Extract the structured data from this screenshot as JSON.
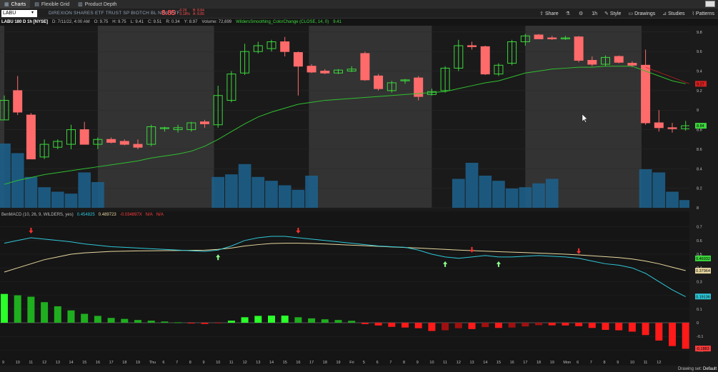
{
  "tabs": [
    {
      "label": "Charts",
      "icon": "chart-icon",
      "active": true
    },
    {
      "label": "Flexible Grid",
      "icon": "grid-icon",
      "active": false
    },
    {
      "label": "Product Depth",
      "icon": "depth-icon",
      "active": false
    }
  ],
  "header": {
    "symbol": "LABU",
    "description": "DIREXION SHARES ETF TRUST SP BIOTCH BL NEW ETF",
    "last_price": "8.85",
    "change": "-0.29",
    "change_pct": "-3.18%",
    "bid": "B: 8.84",
    "ask": "A: 8.85"
  },
  "toolbar": {
    "share": "Share",
    "timeframe": "1h",
    "style": "Style",
    "drawings": "Drawings",
    "studies": "Studies",
    "patterns": "Patterns"
  },
  "infobar": {
    "symbol": "LABU 180 D 1h [NYSE]",
    "date": "D: 7/11/22, 4:00 AM",
    "open": "O: 9.75",
    "high": "H: 9.75",
    "low": "L: 9.41",
    "close": "C: 9.51",
    "range": "R: 0.34",
    "typical": "Y: 8.97",
    "volume": "Volume: 72,699",
    "study": "WildersSmoothing_ColorChange (CLOSE, 14, 0)",
    "study_value": "9.41"
  },
  "macd_header": {
    "name": "BenMACD (10, 26, 9, WILDERS, yes)",
    "value": "0.454825",
    "avg": "0.489723",
    "diff": "-0.034897X",
    "na1": "N/A",
    "na2": "N/A"
  },
  "footer": {
    "label": "Drawing set:",
    "value": "Default"
  },
  "colors": {
    "up": "#3cd83c",
    "down": "#ff6b6b",
    "volume": "#1d5f8a",
    "ma": "#2fbf2f",
    "macd_line": "#2ec7d8",
    "macd_avg": "#e8d8a0",
    "hist_pos": "#1fae1f",
    "hist_neg": "#d81515",
    "price_tag": "#d62020",
    "last_tag": "#3cd83c"
  },
  "chart_data": [
    {
      "type": "candlestick",
      "title": "LABU 180 D 1h [NYSE]",
      "ylim": [
        8.0,
        9.85
      ],
      "yticks": [
        "9.8",
        "9.6",
        "9.4",
        "9.2",
        "9",
        "8.8",
        "8.6",
        "8.4",
        "8.2",
        "8"
      ],
      "price_tags": [
        {
          "label": "9.27",
          "value": 9.27,
          "color": "#d62020"
        },
        {
          "label": "8.84",
          "value": 8.84,
          "color": "#3cd83c"
        }
      ],
      "x_labels": [
        "9",
        "10",
        "11",
        "12",
        "13",
        "14",
        "15",
        "16",
        "17",
        "18",
        "19",
        "Thu",
        "6",
        "7",
        "8",
        "9",
        "10",
        "11",
        "12",
        "13",
        "14",
        "15",
        "16",
        "17",
        "18",
        "19",
        "Fri",
        "5",
        "6",
        "7",
        "8",
        "9",
        "10",
        "11",
        "12",
        "13",
        "14",
        "15",
        "16",
        "17",
        "18",
        "19",
        "Mon",
        "6",
        "7",
        "8",
        "9",
        "10",
        "11",
        "12"
      ],
      "candles": [
        {
          "o": 8.9,
          "h": 9.15,
          "l": 8.9,
          "c": 9.1
        },
        {
          "o": 9.2,
          "h": 9.35,
          "l": 8.95,
          "c": 8.98
        },
        {
          "o": 8.95,
          "h": 8.97,
          "l": 8.5,
          "c": 8.5
        },
        {
          "o": 8.52,
          "h": 8.7,
          "l": 8.5,
          "c": 8.65
        },
        {
          "o": 8.62,
          "h": 8.7,
          "l": 8.6,
          "c": 8.68
        },
        {
          "o": 8.65,
          "h": 8.85,
          "l": 8.6,
          "c": 8.8
        },
        {
          "o": 8.8,
          "h": 8.88,
          "l": 8.65,
          "c": 8.65
        },
        {
          "o": 8.65,
          "h": 8.72,
          "l": 8.6,
          "c": 8.7
        },
        {
          "o": 8.7,
          "h": 8.72,
          "l": 8.66,
          "c": 8.67
        },
        {
          "o": 8.68,
          "h": 8.7,
          "l": 8.64,
          "c": 8.65
        },
        {
          "o": 8.65,
          "h": 8.7,
          "l": 8.6,
          "c": 8.62
        },
        {
          "o": 8.65,
          "h": 8.85,
          "l": 8.63,
          "c": 8.83
        },
        {
          "o": 8.81,
          "h": 8.83,
          "l": 8.78,
          "c": 8.82
        },
        {
          "o": 8.8,
          "h": 8.85,
          "l": 8.77,
          "c": 8.82
        },
        {
          "o": 8.8,
          "h": 8.88,
          "l": 8.78,
          "c": 8.87
        },
        {
          "o": 8.88,
          "h": 8.9,
          "l": 8.82,
          "c": 8.86
        },
        {
          "o": 8.85,
          "h": 9.25,
          "l": 8.82,
          "c": 9.15
        },
        {
          "o": 9.1,
          "h": 9.4,
          "l": 9.08,
          "c": 9.37
        },
        {
          "o": 9.38,
          "h": 9.68,
          "l": 9.36,
          "c": 9.6
        },
        {
          "o": 9.6,
          "h": 9.7,
          "l": 9.58,
          "c": 9.66
        },
        {
          "o": 9.63,
          "h": 9.72,
          "l": 9.6,
          "c": 9.7
        },
        {
          "o": 9.7,
          "h": 9.75,
          "l": 9.55,
          "c": 9.6
        },
        {
          "o": 9.59,
          "h": 9.6,
          "l": 9.15,
          "c": 9.45
        },
        {
          "o": 9.45,
          "h": 9.47,
          "l": 9.38,
          "c": 9.39
        },
        {
          "o": 9.4,
          "h": 9.42,
          "l": 9.37,
          "c": 9.38
        },
        {
          "o": 9.38,
          "h": 9.42,
          "l": 9.37,
          "c": 9.41
        },
        {
          "o": 9.4,
          "h": 9.45,
          "l": 9.39,
          "c": 9.42
        },
        {
          "o": 9.58,
          "h": 9.6,
          "l": 9.3,
          "c": 9.31
        },
        {
          "o": 9.35,
          "h": 9.37,
          "l": 9.2,
          "c": 9.22
        },
        {
          "o": 9.2,
          "h": 9.3,
          "l": 9.18,
          "c": 9.28
        },
        {
          "o": 9.3,
          "h": 9.32,
          "l": 9.27,
          "c": 9.31
        },
        {
          "o": 9.33,
          "h": 9.35,
          "l": 9.1,
          "c": 9.14
        },
        {
          "o": 9.16,
          "h": 9.22,
          "l": 9.15,
          "c": 9.19
        },
        {
          "o": 9.2,
          "h": 9.45,
          "l": 9.18,
          "c": 9.43
        },
        {
          "o": 9.43,
          "h": 9.72,
          "l": 9.4,
          "c": 9.66
        },
        {
          "o": 9.66,
          "h": 9.7,
          "l": 9.62,
          "c": 9.65
        },
        {
          "o": 9.65,
          "h": 9.66,
          "l": 9.36,
          "c": 9.37
        },
        {
          "o": 9.37,
          "h": 9.48,
          "l": 9.35,
          "c": 9.46
        },
        {
          "o": 9.48,
          "h": 9.72,
          "l": 9.46,
          "c": 9.7
        },
        {
          "o": 9.7,
          "h": 9.78,
          "l": 9.66,
          "c": 9.76
        },
        {
          "o": 9.77,
          "h": 9.78,
          "l": 9.73,
          "c": 9.73
        },
        {
          "o": 9.74,
          "h": 9.76,
          "l": 9.72,
          "c": 9.73
        },
        {
          "o": 9.73,
          "h": 9.76,
          "l": 9.72,
          "c": 9.74
        },
        {
          "o": 9.75,
          "h": 9.76,
          "l": 9.49,
          "c": 9.51
        },
        {
          "o": 9.51,
          "h": 9.55,
          "l": 9.45,
          "c": 9.47
        },
        {
          "o": 9.47,
          "h": 9.56,
          "l": 9.45,
          "c": 9.54
        },
        {
          "o": 9.55,
          "h": 9.56,
          "l": 9.48,
          "c": 9.49
        },
        {
          "o": 9.48,
          "h": 9.5,
          "l": 9.44,
          "c": 9.46
        },
        {
          "o": 9.46,
          "h": 9.62,
          "l": 8.85,
          "c": 8.87
        },
        {
          "o": 8.87,
          "h": 9.0,
          "l": 8.78,
          "c": 8.82
        },
        {
          "o": 8.82,
          "h": 8.87,
          "l": 8.77,
          "c": 8.81
        },
        {
          "o": 8.81,
          "h": 8.89,
          "l": 8.79,
          "c": 8.84
        }
      ],
      "volume": [
        1.0,
        0.85,
        0.48,
        0.32,
        0.25,
        0.22,
        0.55,
        0.4,
        0,
        0,
        0,
        0,
        0,
        0,
        0,
        0,
        0.48,
        0.52,
        0.68,
        0.48,
        0.42,
        0.35,
        0.28,
        0.5,
        0,
        0,
        0,
        0,
        0,
        0,
        0,
        0,
        0,
        0,
        0.45,
        0.7,
        0.5,
        0.42,
        0.3,
        0.32,
        0.38,
        0.45,
        0,
        0,
        0,
        0,
        0,
        0,
        0.6,
        0.55,
        0.25,
        0.12
      ],
      "moving_average": [
        8.24,
        8.28,
        8.31,
        8.34,
        8.36,
        8.38,
        8.4,
        8.42,
        8.44,
        8.46,
        8.48,
        8.51,
        8.53,
        8.55,
        8.58,
        8.63,
        8.7,
        8.78,
        8.86,
        8.93,
        8.98,
        9.02,
        9.06,
        9.08,
        9.1,
        9.11,
        9.12,
        9.13,
        9.14,
        9.15,
        9.16,
        9.17,
        9.18,
        9.19,
        9.22,
        9.25,
        9.28,
        9.3,
        9.34,
        9.38,
        9.4,
        9.42,
        9.43,
        9.44,
        9.44,
        9.45,
        9.45,
        9.45,
        9.4,
        9.35,
        9.3,
        9.27
      ]
    },
    {
      "type": "line",
      "title": "BenMACD (10, 26, 9, WILDERS, yes)",
      "ylim": [
        -0.25,
        0.75
      ],
      "yticks": [
        "0.7",
        "0.6",
        "0.5",
        "0.4",
        "0.3",
        "0.2",
        "0.1",
        "0",
        "-0.1",
        "-0.2"
      ],
      "value_tags": [
        {
          "label": "0.46932",
          "value": 0.4693,
          "color": "#3cd83c"
        },
        {
          "label": "0.37964",
          "value": 0.3796,
          "color": "#e8d8a0"
        },
        {
          "label": "0.19136",
          "value": 0.1914,
          "color": "#2ec7d8"
        },
        {
          "label": "-0.1883",
          "value": -0.1883,
          "color": "#ff3c3c"
        }
      ],
      "macd": [
        0.58,
        0.6,
        0.62,
        0.61,
        0.6,
        0.59,
        0.575,
        0.565,
        0.555,
        0.55,
        0.545,
        0.54,
        0.535,
        0.53,
        0.525,
        0.52,
        0.53,
        0.56,
        0.6,
        0.62,
        0.63,
        0.63,
        0.62,
        0.61,
        0.6,
        0.59,
        0.58,
        0.57,
        0.56,
        0.555,
        0.55,
        0.53,
        0.5,
        0.48,
        0.47,
        0.48,
        0.49,
        0.48,
        0.48,
        0.485,
        0.49,
        0.485,
        0.48,
        0.47,
        0.45,
        0.43,
        0.42,
        0.4,
        0.36,
        0.3,
        0.24,
        0.19
      ],
      "signal": [
        0.37,
        0.4,
        0.43,
        0.46,
        0.48,
        0.5,
        0.51,
        0.515,
        0.52,
        0.522,
        0.524,
        0.525,
        0.526,
        0.527,
        0.528,
        0.529,
        0.535,
        0.545,
        0.56,
        0.57,
        0.578,
        0.58,
        0.58,
        0.578,
        0.575,
        0.57,
        0.566,
        0.562,
        0.557,
        0.553,
        0.549,
        0.545,
        0.54,
        0.535,
        0.53,
        0.526,
        0.522,
        0.518,
        0.515,
        0.512,
        0.508,
        0.504,
        0.5,
        0.495,
        0.488,
        0.482,
        0.475,
        0.465,
        0.45,
        0.43,
        0.405,
        0.38
      ],
      "histogram": [
        0.21,
        0.2,
        0.19,
        0.15,
        0.12,
        0.09,
        0.065,
        0.05,
        0.035,
        0.028,
        0.02,
        0.015,
        0.009,
        0.003,
        -0.003,
        -0.009,
        -0.005,
        0.015,
        0.04,
        0.05,
        0.052,
        0.052,
        0.04,
        0.032,
        0.025,
        0.02,
        0.014,
        -0.01,
        -0.02,
        -0.03,
        -0.035,
        -0.04,
        -0.06,
        -0.055,
        -0.04,
        -0.046,
        -0.032,
        -0.038,
        -0.035,
        -0.027,
        -0.018,
        -0.019,
        -0.02,
        -0.025,
        -0.038,
        -0.052,
        -0.055,
        -0.065,
        -0.09,
        -0.13,
        -0.17,
        -0.19
      ],
      "up_arrows": [
        16,
        33,
        37
      ],
      "down_arrows": [
        2,
        22,
        35,
        43
      ]
    }
  ]
}
